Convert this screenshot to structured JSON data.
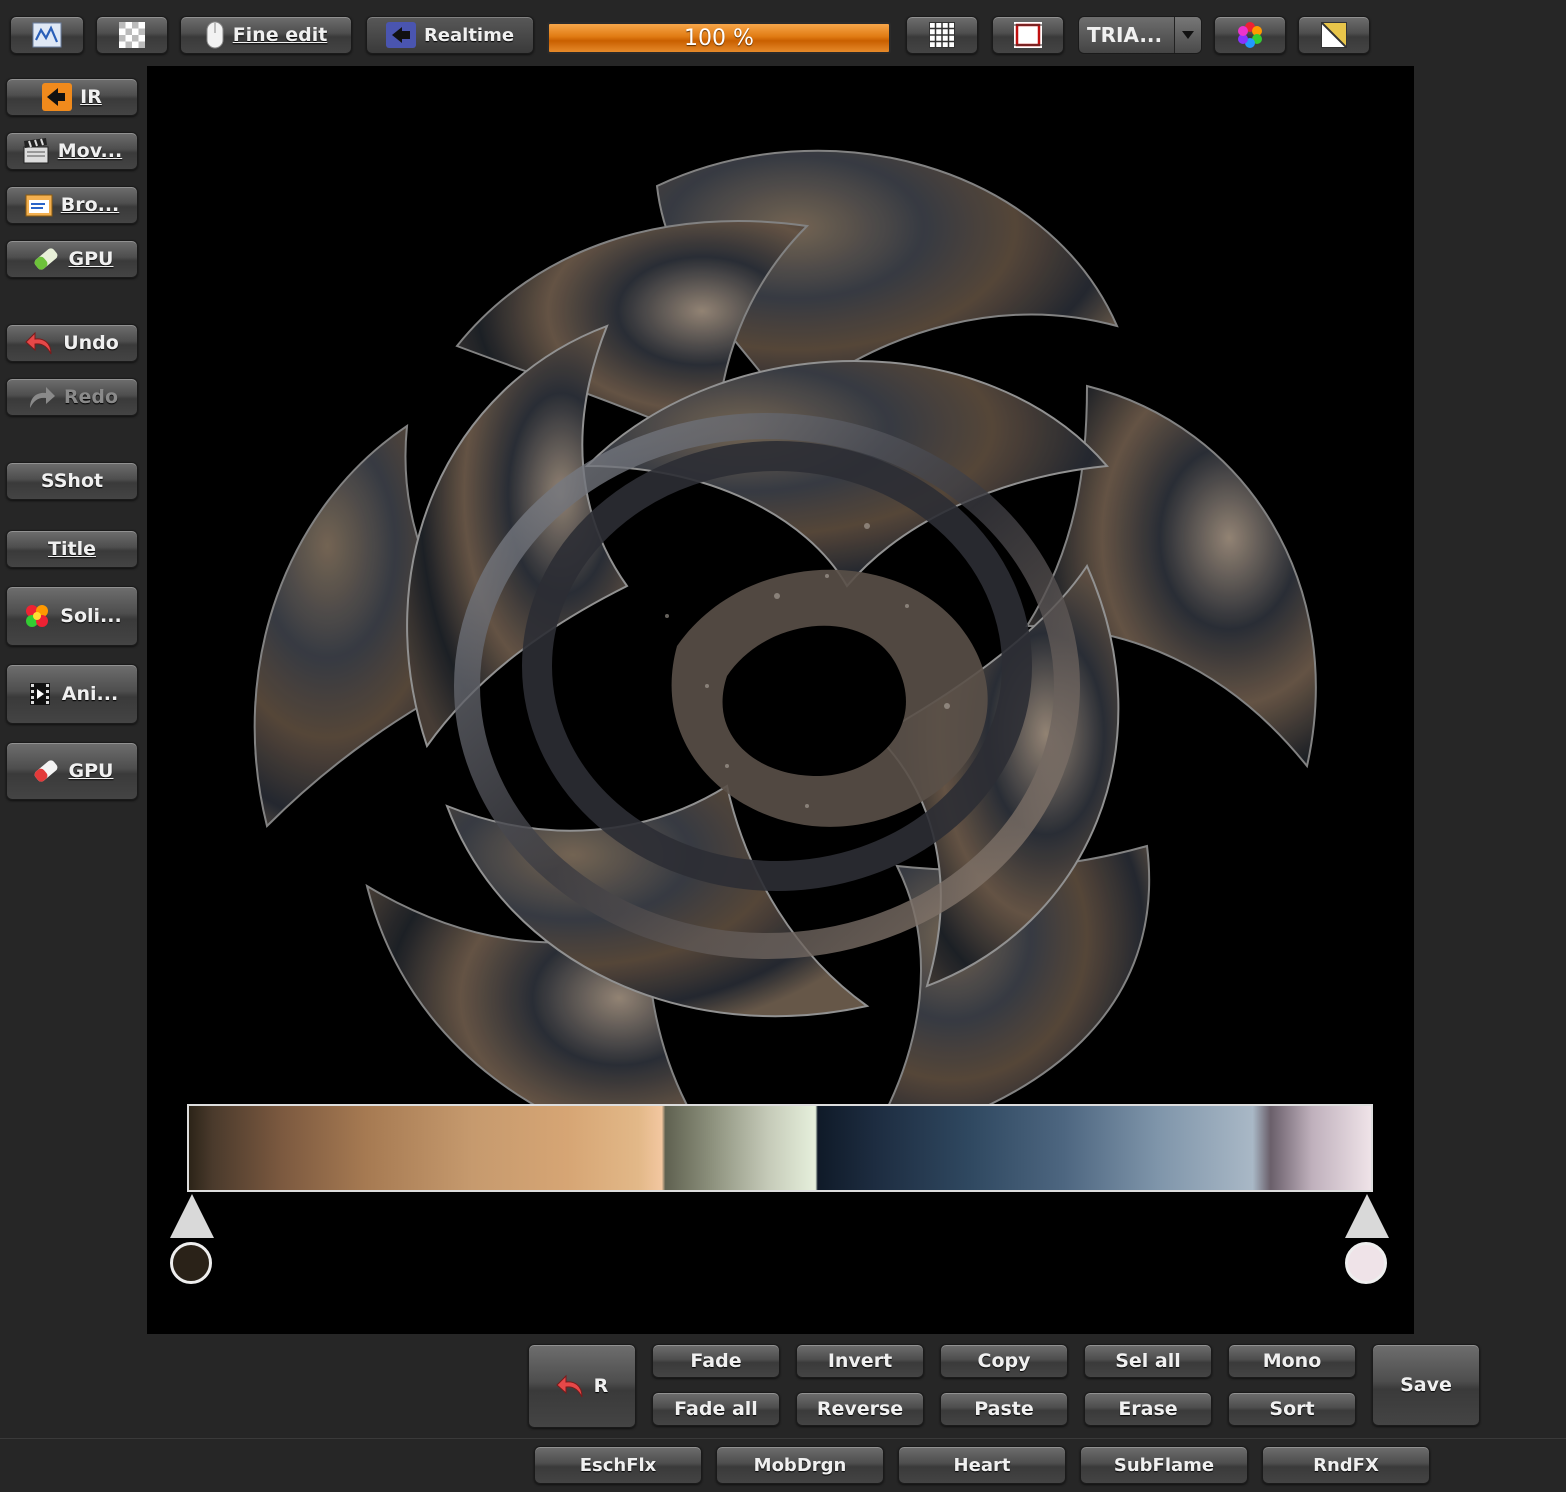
{
  "toolbar": {
    "fine_edit_label": "Fine edit",
    "realtime_label": "Realtime",
    "progress": {
      "percent": 100,
      "label": "100 %"
    },
    "triangle_combo": {
      "value": "TRIA..."
    }
  },
  "sidebar": {
    "ir_label": "IR",
    "movie_label": "Mov...",
    "browser_label": "Bro...",
    "gpu_top_label": "GPU",
    "undo_label": "Undo",
    "redo_label": "Redo",
    "sshot_label": "SShot",
    "title_label": "Title",
    "solid_label": "Soli...",
    "anim_label": "Ani...",
    "gpu_bottom_label": "GPU"
  },
  "gradient": {
    "left_color": "#2a2218",
    "right_color": "#efe3e8",
    "stops": [
      {
        "color": "#2c2418",
        "at": 0
      },
      {
        "color": "#4a3a2c",
        "at": 2
      },
      {
        "color": "#7d5a40",
        "at": 8
      },
      {
        "color": "#a67a52",
        "at": 15
      },
      {
        "color": "#c69a6e",
        "at": 24
      },
      {
        "color": "#d6a574",
        "at": 32
      },
      {
        "color": "#e2b888",
        "at": 38
      },
      {
        "color": "#f3c7a0",
        "at": 40
      },
      {
        "color": "#5f6150",
        "at": 40.3
      },
      {
        "color": "#8a8e7a",
        "at": 44
      },
      {
        "color": "#c5cab8",
        "at": 49
      },
      {
        "color": "#e6f0dc",
        "at": 53
      },
      {
        "color": "#0f1a28",
        "at": 53.2
      },
      {
        "color": "#1d2c40",
        "at": 58
      },
      {
        "color": "#2f4860",
        "at": 66
      },
      {
        "color": "#4d6680",
        "at": 74
      },
      {
        "color": "#7f95aa",
        "at": 82
      },
      {
        "color": "#a9b8c6",
        "at": 90
      },
      {
        "color": "#6a5f6a",
        "at": 91.5
      },
      {
        "color": "#bfb0bc",
        "at": 95
      },
      {
        "color": "#efe3e8",
        "at": 100
      }
    ]
  },
  "bottom": {
    "r_label": "R",
    "fade_label": "Fade",
    "fade_all_label": "Fade all",
    "invert_label": "Invert",
    "reverse_label": "Reverse",
    "copy_label": "Copy",
    "paste_label": "Paste",
    "sel_all_label": "Sel all",
    "erase_label": "Erase",
    "mono_label": "Mono",
    "sort_label": "Sort",
    "save_label": "Save"
  },
  "fx": {
    "eschflx_label": "EschFlx",
    "mobdrgn_label": "MobDrgn",
    "heart_label": "Heart",
    "subflame_label": "SubFlame",
    "rndfx_label": "RndFX"
  },
  "colors": {
    "accent_orange": "#e07b13",
    "panel_bg": "#262626",
    "canvas_bg": "#000000"
  }
}
